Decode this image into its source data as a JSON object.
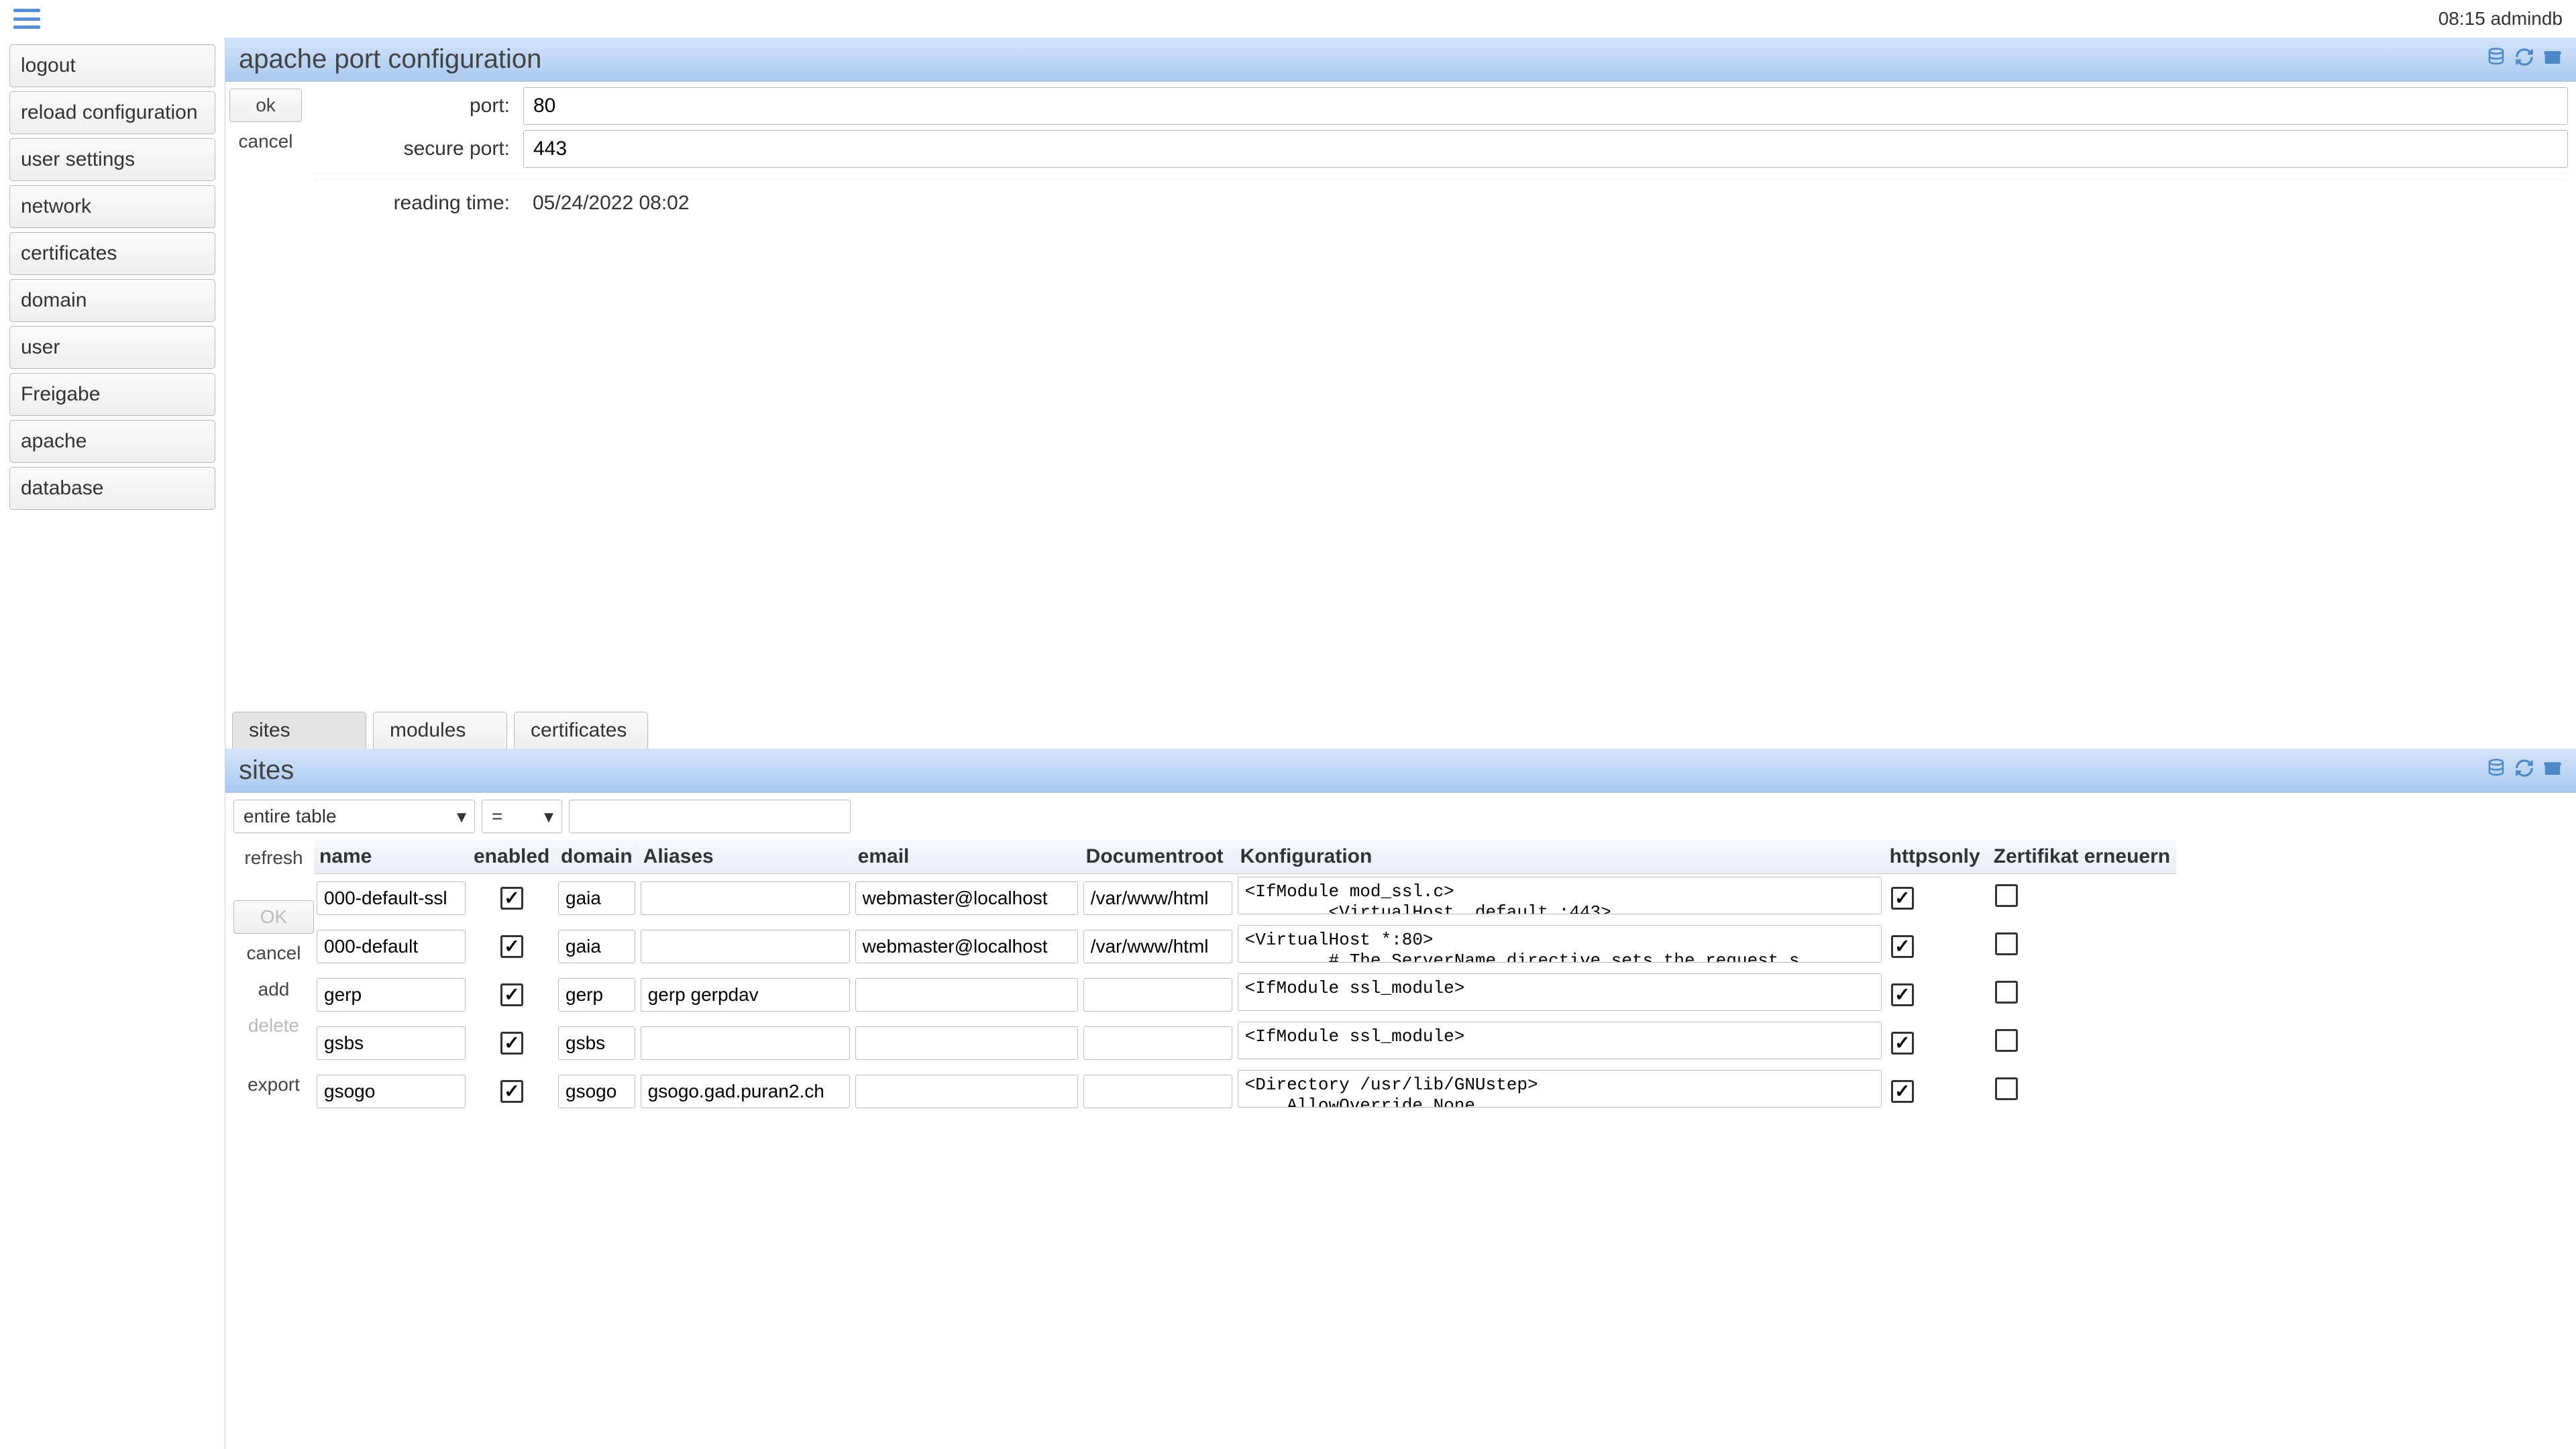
{
  "topbar": {
    "time": "08:15",
    "user": "admindb"
  },
  "sidebar": {
    "items": [
      "logout",
      "reload configuration",
      "user settings",
      "network",
      "certificates",
      "domain",
      "user",
      "Freigabe",
      "apache",
      "database"
    ]
  },
  "upper": {
    "title": "apache port configuration",
    "actions": {
      "ok": "ok",
      "cancel": "cancel"
    },
    "form": {
      "port_label": "port:",
      "port_value": "80",
      "sport_label": "secure port:",
      "sport_value": "443",
      "rtime_label": "reading time:",
      "rtime_value": "05/24/2022 08:02"
    }
  },
  "tabs": {
    "sites": "sites",
    "modules": "modules",
    "certificates": "certificates"
  },
  "lower": {
    "title": "sites",
    "filter": {
      "scope": "entire table",
      "op": "=",
      "value": ""
    },
    "actions": {
      "refresh": "refresh",
      "ok": "OK",
      "cancel": "cancel",
      "add": "add",
      "delete": "delete",
      "export": "export"
    },
    "headers": {
      "name": "name",
      "enabled": "enabled",
      "domain": "domain",
      "aliases": "Aliases",
      "email": "email",
      "docroot": "Documentroot",
      "konfig": "Konfiguration",
      "httpsonly": "httpsonly",
      "cert": "Zertifikat erneuern"
    },
    "rows": [
      {
        "name": "000-default-ssl",
        "enabled": true,
        "domain": "gaia",
        "aliases": "",
        "email": "webmaster@localhost",
        "docroot": "/var/www/html",
        "konfig": "<IfModule mod_ssl.c>\n        <VirtualHost _default_:443>",
        "httpsonly": true,
        "cert": false
      },
      {
        "name": "000-default",
        "enabled": true,
        "domain": "gaia",
        "aliases": "",
        "email": "webmaster@localhost",
        "docroot": "/var/www/html",
        "konfig": "<VirtualHost *:80>\n        # The ServerName directive sets the request s",
        "httpsonly": true,
        "cert": false
      },
      {
        "name": "gerp",
        "enabled": true,
        "domain": "gerp",
        "aliases": "gerp gerpdav",
        "email": "",
        "docroot": "",
        "konfig": "<IfModule ssl_module>",
        "httpsonly": true,
        "cert": false
      },
      {
        "name": "gsbs",
        "enabled": true,
        "domain": "gsbs",
        "aliases": "",
        "email": "",
        "docroot": "",
        "konfig": "<IfModule ssl_module>",
        "httpsonly": true,
        "cert": false
      },
      {
        "name": "gsogo",
        "enabled": true,
        "domain": "gsogo",
        "aliases": "gsogo.gad.puran2.ch",
        "email": "",
        "docroot": "",
        "konfig": "<Directory /usr/lib/GNUstep>\n    AllowOverride None",
        "httpsonly": true,
        "cert": false
      }
    ]
  }
}
